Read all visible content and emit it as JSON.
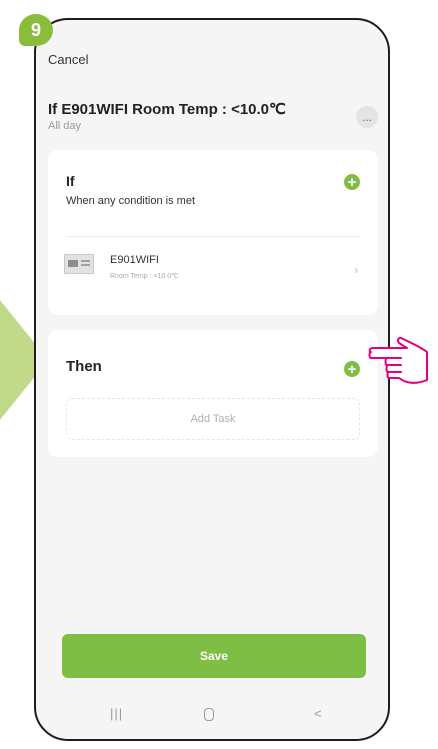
{
  "step_number": "9",
  "header": {
    "cancel_label": "Cancel",
    "title": "If E901WIFI Room Temp : <10.0℃",
    "subtitle": "All day",
    "more_label": "..."
  },
  "if_card": {
    "heading": "If",
    "condition_text": "When any condition is met",
    "add_label": "+",
    "device": {
      "name": "E901WIFI",
      "detail": "Room Temp : <10.0℃",
      "chevron": "›"
    }
  },
  "then_card": {
    "heading": "Then",
    "add_label": "+",
    "add_task_label": "Add Task"
  },
  "save_label": "Save",
  "nav": {
    "recent": "|||",
    "back": "<"
  },
  "colors": {
    "accent": "#7fbe45",
    "badge": "#8bbd3d",
    "pointer": "#e6007e",
    "arrow": "#c3d98a"
  }
}
